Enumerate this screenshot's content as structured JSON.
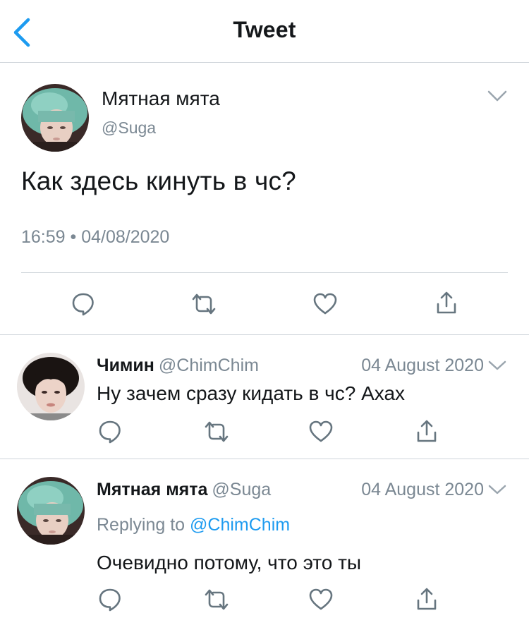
{
  "header": {
    "title": "Tweet"
  },
  "main_tweet": {
    "display_name": "Мятная мята",
    "handle": "@Suga",
    "text": "Как здесь кинуть в чс?",
    "timestamp": "16:59 • 04/08/2020"
  },
  "replies": [
    {
      "display_name": "Чимин",
      "handle": "@ChimChim",
      "date": "04 August 2020",
      "text": "Ну зачем сразу кидать в чс? Ахах"
    },
    {
      "display_name": "Мятная мята",
      "handle": "@Suga",
      "date": "04 August 2020",
      "replying_prefix": "Replying to",
      "replying_to": "@ChimChim",
      "text": "Очевидно потому, что это ты"
    }
  ],
  "icons": {
    "back": "chevron-left-icon",
    "more": "chevron-down-icon",
    "reply": "comment-icon",
    "retweet": "retweet-icon",
    "like": "heart-icon",
    "share": "share-icon"
  },
  "colors": {
    "accent": "#1d9bf0",
    "secondary_text": "#7b8893",
    "icon_gray": "#66757f",
    "divider": "#cfd5da"
  }
}
